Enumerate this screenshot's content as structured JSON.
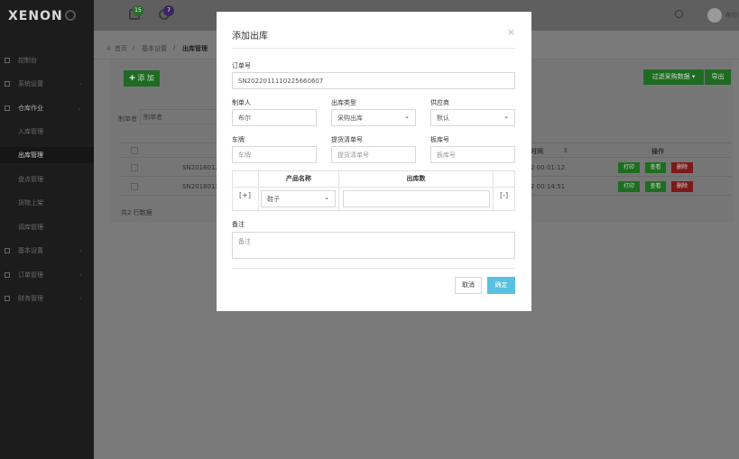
{
  "app": {
    "logo": "XENON",
    "user_name": "布尔"
  },
  "topbar": {
    "badges": [
      "15",
      "7"
    ]
  },
  "sidebar": {
    "items": [
      {
        "label": "控制台",
        "arrow": ""
      },
      {
        "label": "系统设置",
        "arrow": "›"
      },
      {
        "label": "仓库作业",
        "arrow": "⌄"
      },
      {
        "label": "入库管理",
        "arrow": ""
      },
      {
        "label": "出库管理",
        "arrow": ""
      },
      {
        "label": "盘点管理",
        "arrow": ""
      },
      {
        "label": "货物上架",
        "arrow": ""
      },
      {
        "label": "调库管理",
        "arrow": ""
      },
      {
        "label": "基本设置",
        "arrow": "›"
      },
      {
        "label": "订单管理",
        "arrow": "›"
      },
      {
        "label": "财务管理",
        "arrow": "›"
      }
    ]
  },
  "breadcrumb": {
    "home": "首页",
    "parent": "基本设置",
    "current": "出库管理",
    "sep": "/"
  },
  "toolbar": {
    "add_label": "✚ 添 加",
    "filter_label": "过滤采购数据 ▾",
    "export_label": "导出"
  },
  "filter": {
    "label": "制单者",
    "placeholder": "制单者"
  },
  "table": {
    "time_header": "时间",
    "ops_header": "操作",
    "rows": [
      {
        "order": "SN20180122",
        "time": "2 00:01:12"
      },
      {
        "order": "SN20180122",
        "time": "2 00:14:51"
      }
    ],
    "ops": {
      "print": "打印",
      "view": "查看",
      "delete": "删除"
    },
    "count_text": "共2 行数据"
  },
  "modal": {
    "title": "添加出库",
    "close": "×",
    "order_label": "订单号",
    "order_value": "SN2022011110225660607",
    "creator_label": "制单人",
    "creator_value": "布尔",
    "type_label": "出库类型",
    "type_value": "采购出库",
    "supplier_label": "供应商",
    "supplier_value": "默认",
    "plate_label": "车牌",
    "plate_placeholder": "车牌",
    "pickup_label": "提货清单号",
    "pickup_placeholder": "提货清单号",
    "board_label": "板库号",
    "board_placeholder": "板库号",
    "table_product_header": "产品名称",
    "table_qty_header": "出库数",
    "add_row": "[+]",
    "remove_row": "[-]",
    "product_value": "鞋子",
    "note_label": "备注",
    "note_placeholder": "备注",
    "cancel_label": "取消",
    "ok_label": "确定"
  }
}
